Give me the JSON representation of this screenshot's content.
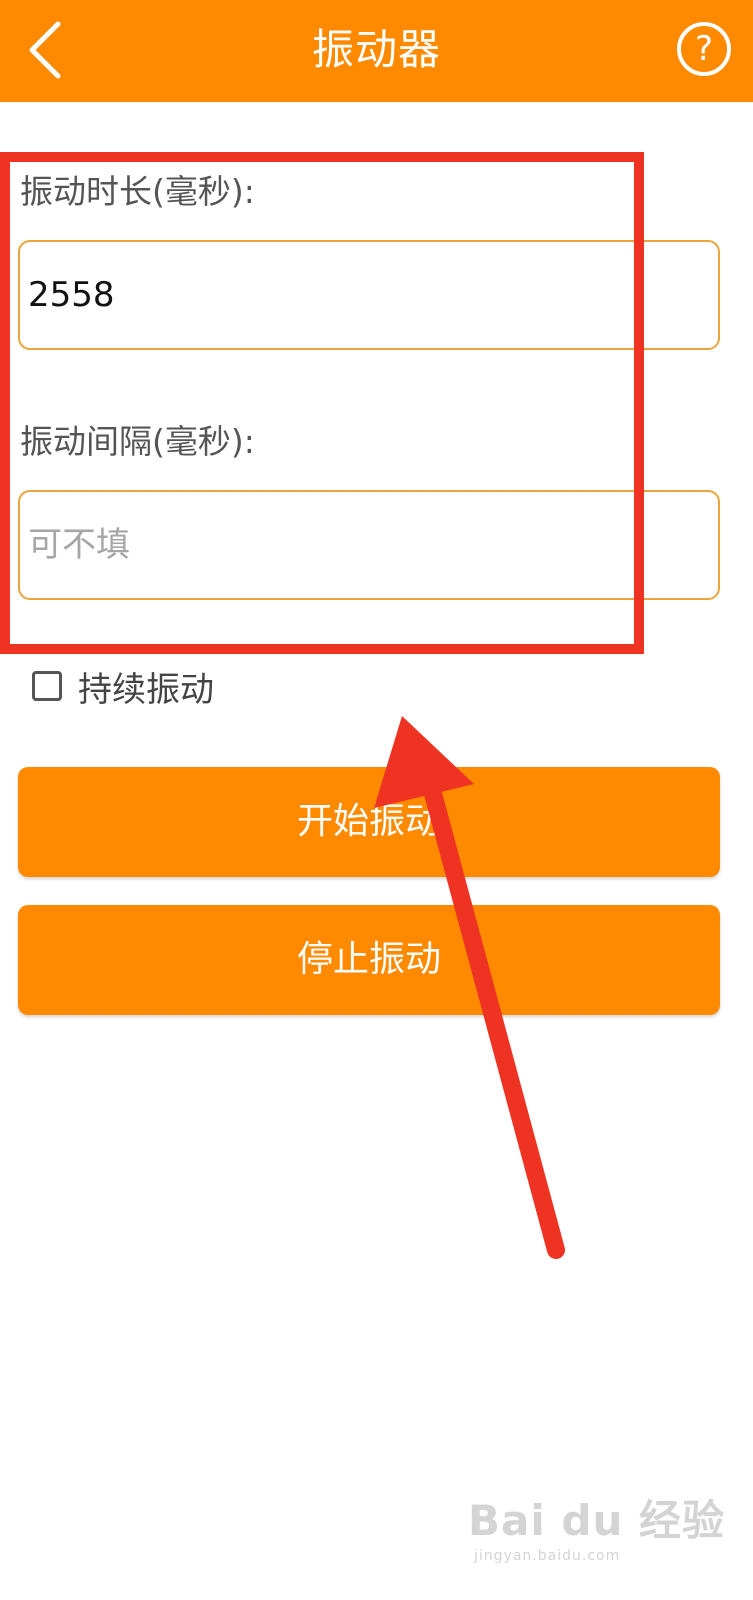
{
  "header": {
    "title": "振动器",
    "back_icon": "chevron-left-icon",
    "help_icon": "question-circle-icon",
    "help_glyph": "?"
  },
  "form": {
    "duration_label": "振动时长(毫秒):",
    "duration_value": "2558",
    "interval_label": "振动间隔(毫秒):",
    "interval_placeholder": "可不填",
    "continuous_label": "持续振动",
    "continuous_checked": false
  },
  "buttons": {
    "start_label": "开始振动",
    "stop_label": "停止振动"
  },
  "watermark": {
    "text": "Bai du 经验",
    "sub": "jingyan.baidu.com"
  },
  "colors": {
    "accent": "#FF8A00",
    "field_border": "#E9A43C",
    "annotation_red": "#EE3322"
  }
}
